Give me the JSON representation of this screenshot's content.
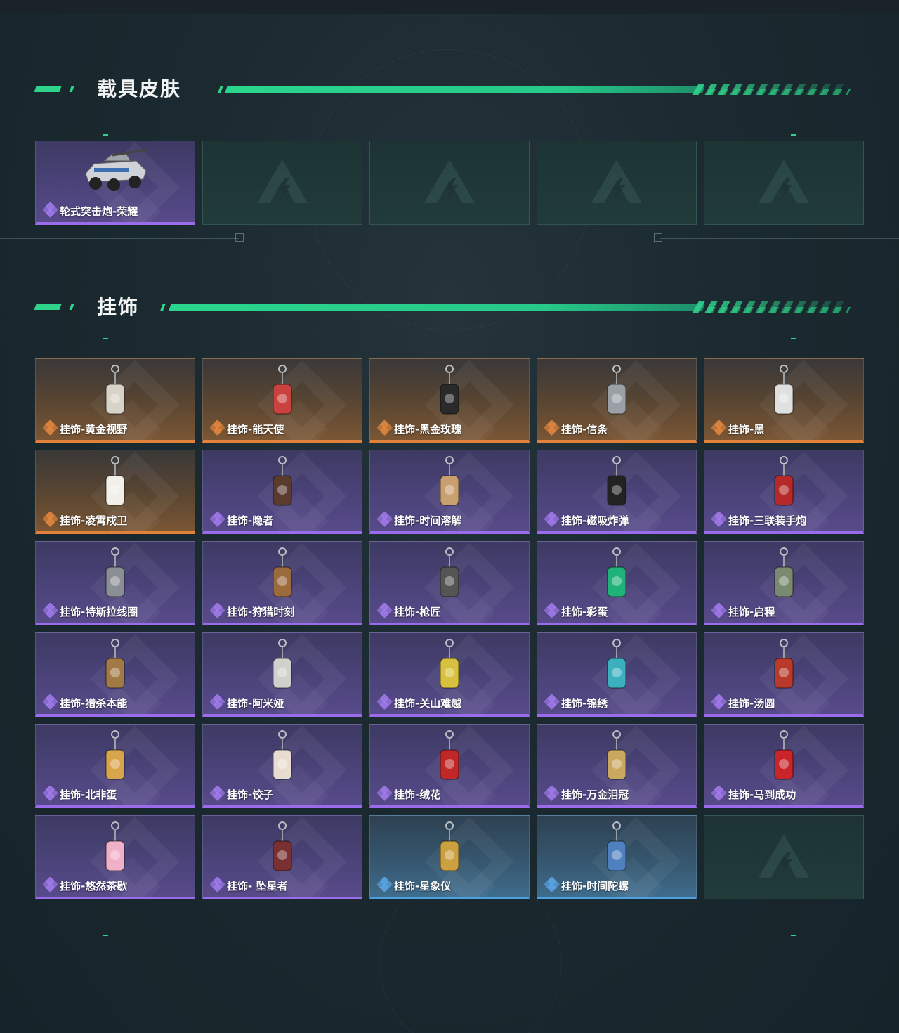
{
  "sections": {
    "vehicle": {
      "title": "载具皮肤",
      "items": [
        {
          "label": "轮式突击炮-荣耀",
          "rarity": "purple",
          "icon": "armored-vehicle-icon"
        },
        {
          "label": "",
          "rarity": "empty",
          "icon": "empty-slot-logo-icon"
        },
        {
          "label": "",
          "rarity": "empty",
          "icon": "empty-slot-logo-icon"
        },
        {
          "label": "",
          "rarity": "empty",
          "icon": "empty-slot-logo-icon"
        },
        {
          "label": "",
          "rarity": "empty",
          "icon": "empty-slot-logo-icon"
        }
      ]
    },
    "charms": {
      "title": "挂饰",
      "items": [
        {
          "label": "挂饰-黄金视野",
          "rarity": "orange"
        },
        {
          "label": "挂饰-能天使",
          "rarity": "orange"
        },
        {
          "label": "挂饰-黑金玫瑰",
          "rarity": "orange"
        },
        {
          "label": "挂饰-信条",
          "rarity": "orange"
        },
        {
          "label": "挂饰-黑",
          "rarity": "orange"
        },
        {
          "label": "挂饰-凌霄戍卫",
          "rarity": "orange"
        },
        {
          "label": "挂饰-隐者",
          "rarity": "purple"
        },
        {
          "label": "挂饰-时间溶解",
          "rarity": "purple"
        },
        {
          "label": "挂饰-磁吸炸弹",
          "rarity": "purple"
        },
        {
          "label": "挂饰-三联装手炮",
          "rarity": "purple"
        },
        {
          "label": "挂饰-特斯拉线圈",
          "rarity": "purple"
        },
        {
          "label": "挂饰-狩猎时刻",
          "rarity": "purple"
        },
        {
          "label": "挂饰-枪匠",
          "rarity": "purple"
        },
        {
          "label": "挂饰-彩蛋",
          "rarity": "purple"
        },
        {
          "label": "挂饰-启程",
          "rarity": "purple"
        },
        {
          "label": "挂饰-猎杀本能",
          "rarity": "purple"
        },
        {
          "label": "挂饰-阿米娅",
          "rarity": "purple"
        },
        {
          "label": "挂饰-关山难越",
          "rarity": "purple"
        },
        {
          "label": "挂饰-锦绣",
          "rarity": "purple"
        },
        {
          "label": "挂饰-汤圆",
          "rarity": "purple"
        },
        {
          "label": "挂饰-北非蛋",
          "rarity": "purple"
        },
        {
          "label": "挂饰-饺子",
          "rarity": "purple"
        },
        {
          "label": "挂饰-绒花",
          "rarity": "purple"
        },
        {
          "label": "挂饰-万金泪冠",
          "rarity": "purple"
        },
        {
          "label": "挂饰-马到成功",
          "rarity": "purple"
        },
        {
          "label": "挂饰-悠然茶歇",
          "rarity": "purple"
        },
        {
          "label": "挂饰- 坠星者",
          "rarity": "purple"
        },
        {
          "label": "挂饰-星象仪",
          "rarity": "blue"
        },
        {
          "label": "挂饰-时间陀螺",
          "rarity": "blue"
        },
        {
          "label": "",
          "rarity": "empty"
        }
      ]
    }
  },
  "colors": {
    "accent_green": "#2fd48a",
    "purple": "#9a6bea",
    "orange": "#e2823a",
    "blue": "#4e9fe0"
  }
}
